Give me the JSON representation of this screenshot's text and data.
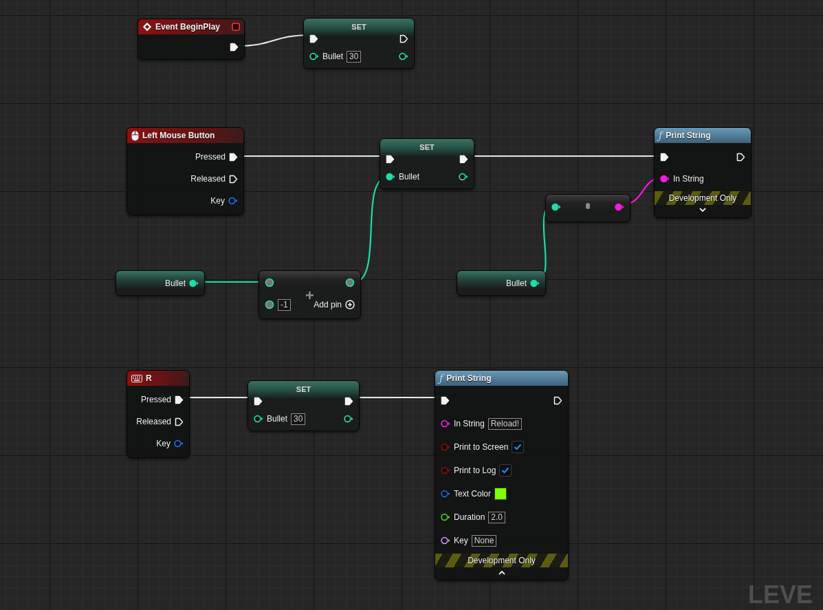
{
  "graph": {
    "nodes": [
      {
        "kind": "event",
        "title": "Event BeginPlay",
        "header_pin": {
          "kind": "delegate",
          "connected": false
        },
        "outputs": [
          {
            "kind": "exec",
            "connected": true
          }
        ]
      },
      {
        "kind": "set",
        "title": "SET",
        "inputs": [
          {
            "kind": "exec",
            "connected": true
          },
          {
            "kind": "int",
            "label": "Bullet",
            "value": "30",
            "connected": false
          }
        ],
        "outputs": [
          {
            "kind": "exec",
            "connected": false
          },
          {
            "kind": "int",
            "connected": false
          }
        ]
      },
      {
        "kind": "mouse_input",
        "title": "Left Mouse Button",
        "outputs": [
          {
            "kind": "exec",
            "label": "Pressed",
            "connected": true
          },
          {
            "kind": "exec",
            "label": "Released",
            "connected": false
          },
          {
            "kind": "key",
            "label": "Key",
            "connected": false
          }
        ]
      },
      {
        "kind": "set",
        "title": "SET",
        "inputs": [
          {
            "kind": "exec",
            "connected": true
          },
          {
            "kind": "int",
            "label": "Bullet",
            "connected": true
          }
        ],
        "outputs": [
          {
            "kind": "exec",
            "connected": true
          },
          {
            "kind": "int",
            "connected": false
          }
        ]
      },
      {
        "kind": "function",
        "glyph": "ƒ",
        "title": "Print String",
        "inputs": [
          {
            "kind": "exec",
            "connected": true
          },
          {
            "kind": "string",
            "label": "In String",
            "connected": true
          }
        ],
        "outputs": [
          {
            "kind": "exec",
            "connected": false
          }
        ],
        "footer": "Development Only",
        "expanded": false
      },
      {
        "kind": "getter",
        "outputs": [
          {
            "kind": "int",
            "label": "Bullet",
            "connected": true
          }
        ]
      },
      {
        "kind": "operator",
        "symbol": "+",
        "inputs": [
          {
            "kind": "wildcard"
          },
          {
            "kind": "wildcard",
            "value": "-1"
          }
        ],
        "outputs": [
          {
            "kind": "wildcard"
          }
        ],
        "add_pin": "Add pin"
      },
      {
        "kind": "convert",
        "inputs": [
          {
            "kind": "int",
            "connected": true
          }
        ],
        "outputs": [
          {
            "kind": "string",
            "connected": true
          }
        ]
      },
      {
        "kind": "getter",
        "outputs": [
          {
            "kind": "int",
            "label": "Bullet",
            "connected": true
          }
        ]
      },
      {
        "kind": "key_input",
        "title": "R",
        "outputs": [
          {
            "kind": "exec",
            "label": "Pressed",
            "connected": true
          },
          {
            "kind": "exec",
            "label": "Released",
            "connected": false
          },
          {
            "kind": "key",
            "label": "Key",
            "connected": false
          }
        ]
      },
      {
        "kind": "set",
        "title": "SET",
        "inputs": [
          {
            "kind": "exec",
            "connected": true
          },
          {
            "kind": "int",
            "label": "Bullet",
            "value": "30",
            "connected": false
          }
        ],
        "outputs": [
          {
            "kind": "exec",
            "connected": true
          },
          {
            "kind": "int",
            "connected": false
          }
        ]
      },
      {
        "kind": "function",
        "glyph": "ƒ",
        "title": "Print String",
        "inputs": [
          {
            "kind": "exec",
            "connected": true
          },
          {
            "kind": "string",
            "label": "In String",
            "value": "Reload!",
            "connected": false
          },
          {
            "kind": "bool",
            "label": "Print to Screen",
            "checked": true,
            "connected": false
          },
          {
            "kind": "bool",
            "label": "Print to Log",
            "checked": true,
            "connected": false
          },
          {
            "kind": "struct",
            "label": "Text Color",
            "color": "#7fff00",
            "connected": false
          },
          {
            "kind": "float",
            "label": "Duration",
            "value": "2.0",
            "connected": false
          },
          {
            "kind": "name",
            "label": "Key",
            "value": "None",
            "connected": false
          }
        ],
        "outputs": [
          {
            "kind": "exec",
            "connected": false
          }
        ],
        "footer": "Development Only",
        "expanded": true
      }
    ]
  },
  "corner_label": "LEVE"
}
